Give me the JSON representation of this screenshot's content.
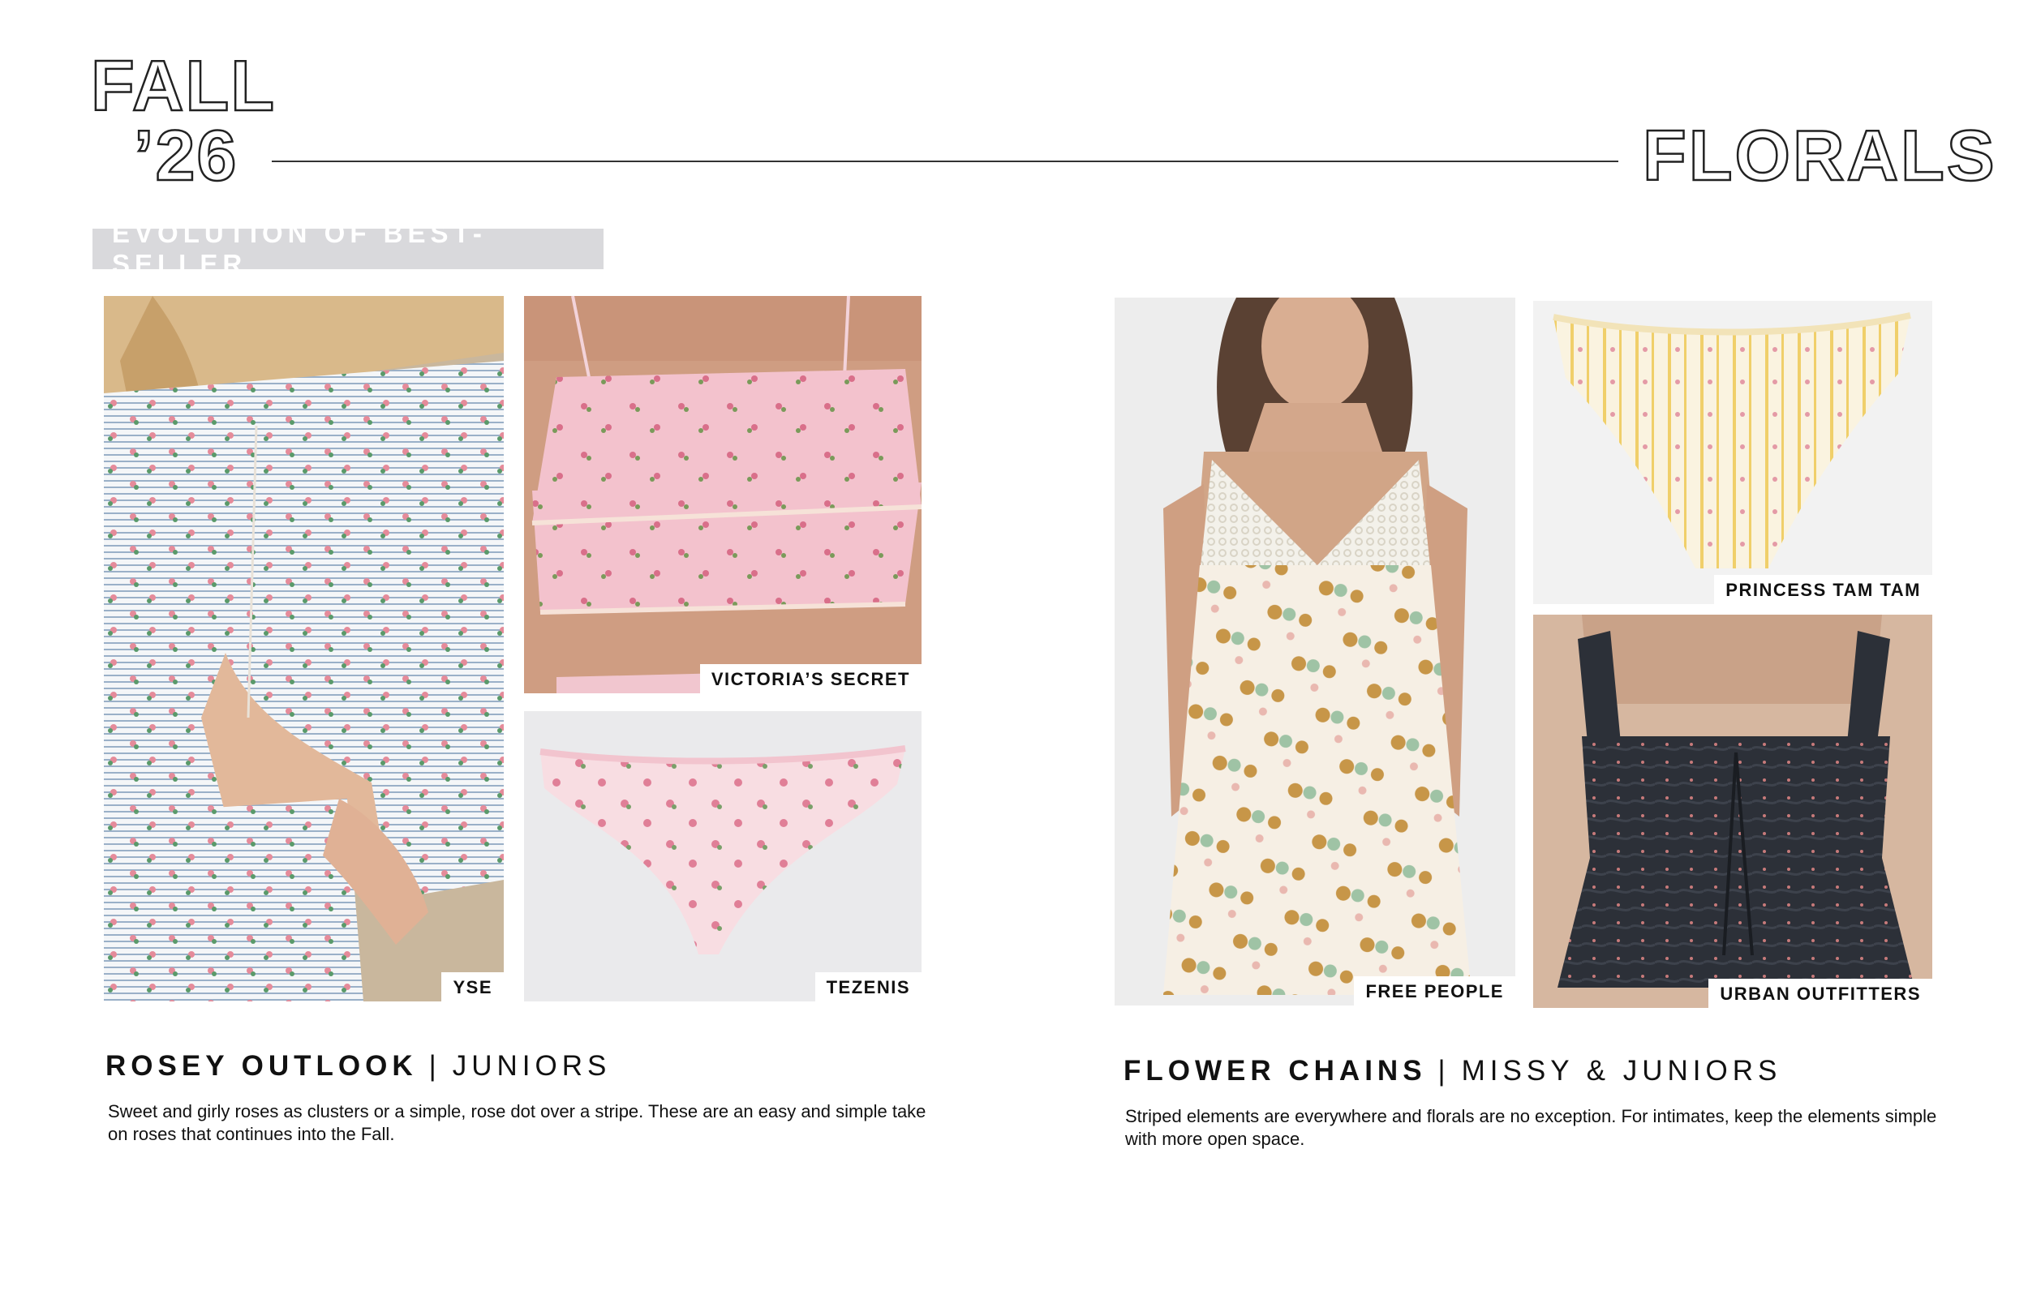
{
  "header": {
    "season_line1": "FALL",
    "season_line2": "’26",
    "theme": "FLORALS"
  },
  "tag": {
    "label": "EVOLUTION OF BEST-SELLER"
  },
  "left_story": {
    "photos": [
      {
        "brand": "YSE",
        "icon": "cardigan-photo"
      },
      {
        "brand": "VICTORIA’S SECRET",
        "icon": "ruffle-top-photo"
      },
      {
        "brand": "TEZENIS",
        "icon": "thong-photo"
      }
    ],
    "title": "ROSEY OUTLOOK",
    "separator": "|",
    "category": "JUNIORS",
    "description": "Sweet and girly roses as clusters or a simple, rose dot over a stripe. These are an easy and simple take on roses that continues into the Fall."
  },
  "right_story": {
    "photos": [
      {
        "brand": "FREE PEOPLE",
        "icon": "slip-dress-photo"
      },
      {
        "brand": "PRINCESS TAM TAM",
        "icon": "brief-photo"
      },
      {
        "brand": "URBAN OUTFITTERS",
        "icon": "ruched-top-photo"
      }
    ],
    "title": "FLOWER CHAINS",
    "separator": "|",
    "category": "MISSY & JUNIORS",
    "description": "Striped elements are everywhere and florals are no exception. For intimates, keep the elements simple with more open space."
  },
  "colors": {
    "tag_bg": "#d9d9dc",
    "rule": "#333333",
    "pink": "#f2c9d3",
    "navy": "#2c3038"
  }
}
